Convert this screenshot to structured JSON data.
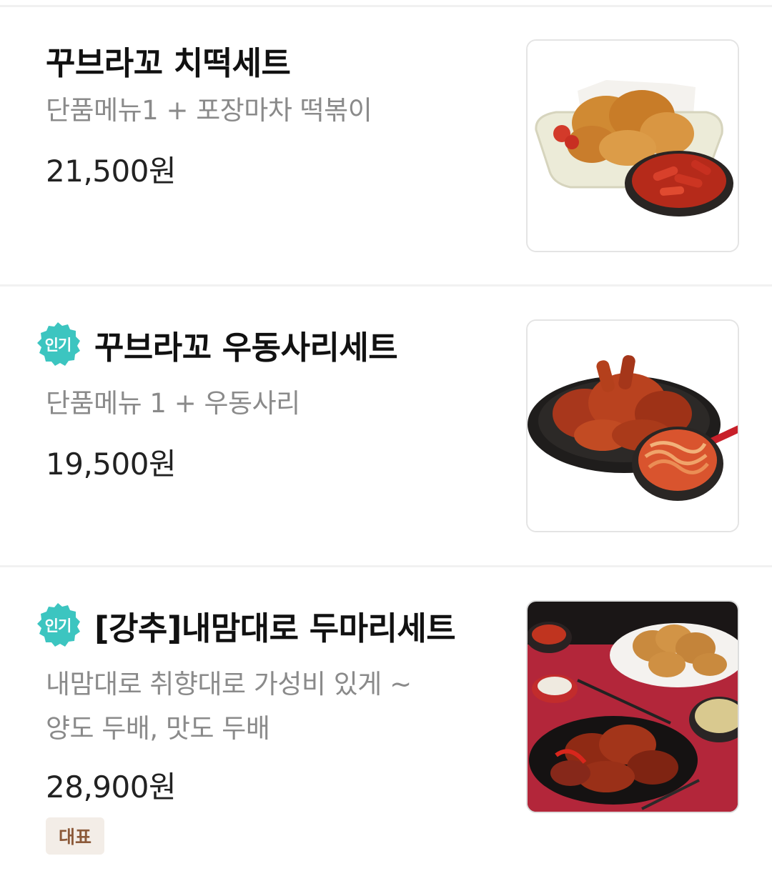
{
  "menu": {
    "items": [
      {
        "title": "꾸브라꼬 치떡세트",
        "badge": "",
        "desc_lines": [
          "단품메뉴1 + 포장마차 떡볶이"
        ],
        "price": "21,500원",
        "tag": "",
        "image_icon": "chicken-tteokbokki-photo"
      },
      {
        "title": "꾸브라꼬 우동사리세트",
        "badge": "인기",
        "desc_lines": [
          "단품메뉴 1 + 우동사리"
        ],
        "price": "19,500원",
        "tag": "",
        "image_icon": "chicken-udon-photo"
      },
      {
        "title": "[강추]내맘대로 두마리세트",
        "badge": "인기",
        "desc_lines": [
          "내맘대로 취향대로 가성비 있게 ~",
          "양도 두배, 맛도 두배"
        ],
        "price": "28,900원",
        "tag": "대표",
        "image_icon": "two-chicken-set-photo"
      }
    ]
  },
  "colors": {
    "badge_teal": "#3cc5c0",
    "tag_bg": "#f3ede7",
    "tag_text": "#8c5a3a"
  }
}
